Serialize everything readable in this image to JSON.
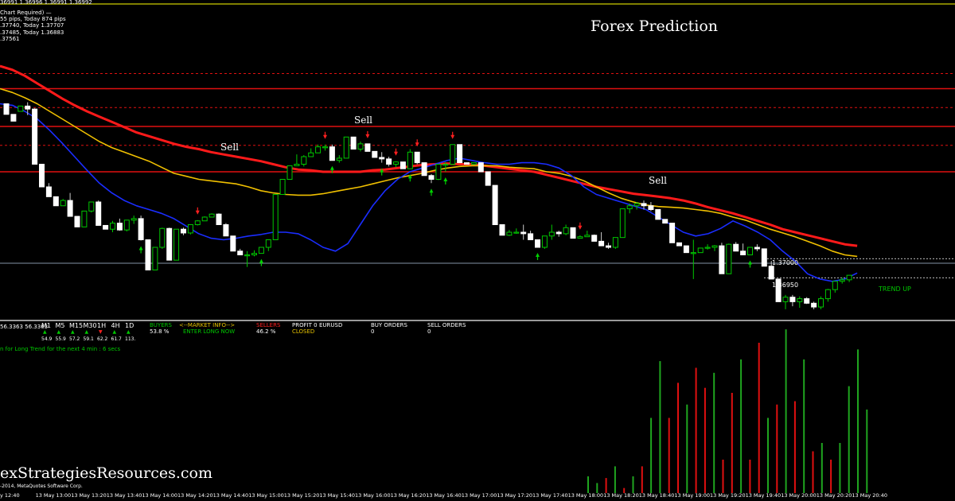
{
  "header": {
    "lines": [
      "36991 1.36996 1.36991 1.36992",
      "Chart Required) —",
      "55 pips, Today 874 pips",
      ".37740, Today 1.37707",
      ".37485, Today 1.36883",
      ".37561"
    ]
  },
  "title": "Forex Prediction",
  "signals": {
    "sell_label": "Sell"
  },
  "price_labels": {
    "upper": "1.37000",
    "lower": "1.36950"
  },
  "trend_label": "TREND UP",
  "info_panel": {
    "price": "56.3363 56.3363",
    "timeframes": [
      "M1",
      "M5",
      "M15",
      "M30",
      "1H",
      "4H",
      "1D"
    ],
    "tf_values": [
      "54.9",
      "55.9",
      "57.2",
      "59.1",
      "62.2",
      "61.7",
      "113."
    ],
    "tf_directions": [
      "up",
      "up",
      "up",
      "up",
      "down",
      "up",
      "up"
    ],
    "buyers_label": "BUYERS",
    "buyers_value": "53.8 %",
    "market_info": "<--MARKET INFO-->",
    "market_action": "ENTER LONG NOW",
    "sellers_label": "SELLERS",
    "sellers_value": "46.2 %",
    "profit_label": "PROFIT 0",
    "symbol": "EURUSD",
    "status": "CLOSED",
    "buy_orders_label": "BUY ORDERS",
    "buy_orders_value": "0",
    "sell_orders_label": "SELL ORDERS",
    "sell_orders_value": "0",
    "trend_message": "n for Long Trend for the next 4 min : 6 secs"
  },
  "footer": {
    "watermark": "exStrategiesResources.com",
    "copyright": "-2014, MetaQuotes Software Corp."
  },
  "time_axis": [
    "y 12:40",
    "13 May 13:00",
    "13 May 13:20",
    "13 May 13:40",
    "13 May 14:00",
    "13 May 14:20",
    "13 May 14:40",
    "13 May 15:00",
    "13 May 15:20",
    "13 May 15:40",
    "13 May 16:00",
    "13 May 16:20",
    "13 May 16:40",
    "13 May 17:00",
    "13 May 17:20",
    "13 May 17:40",
    "13 May 18:00",
    "13 May 18:20",
    "13 May 18:40",
    "13 May 19:00",
    "13 May 19:20",
    "13 May 19:40",
    "13 May 20:00",
    "13 May 20:20",
    "13 May 20:40"
  ],
  "colors": {
    "bull_candle": "#00c800",
    "bear_candle": "#ffffff",
    "ma_fast": "#1a2dff",
    "ma_mid": "#f0c000",
    "ma_slow": "#ff1a1a",
    "level_line": "#e01010",
    "hist_up": "#1fa51f",
    "hist_down": "#e01010"
  },
  "chart_data": {
    "type": "candlestick",
    "candles": [
      [
        0.9,
        0.9,
        0.76,
        0.76
      ],
      [
        0.76,
        0.76,
        0.67,
        0.67
      ],
      [
        0.8,
        0.87,
        0.8,
        0.87
      ],
      [
        0.87,
        0.92,
        0.75,
        0.83
      ],
      [
        0.83,
        0.84,
        0.1,
        0.1
      ],
      [
        0.1,
        0.1,
        -0.2,
        -0.2
      ],
      [
        -0.2,
        -0.15,
        -0.33,
        -0.33
      ],
      [
        -0.33,
        -0.33,
        -0.45,
        -0.45
      ],
      [
        -0.45,
        -0.36,
        -0.45,
        -0.38
      ],
      [
        -0.38,
        -0.28,
        -0.59,
        -0.59
      ],
      [
        -0.59,
        -0.59,
        -0.73,
        -0.73
      ],
      [
        -0.73,
        -0.52,
        -0.73,
        -0.52
      ],
      [
        -0.52,
        -0.4,
        -0.54,
        -0.4
      ],
      [
        -0.4,
        -0.38,
        -0.71,
        -0.71
      ],
      [
        -0.71,
        -0.71,
        -0.76,
        -0.76
      ],
      [
        -0.76,
        -0.65,
        -0.8,
        -0.68
      ],
      [
        -0.68,
        -0.62,
        -0.78,
        -0.77
      ],
      [
        -0.77,
        -0.64,
        -0.79,
        -0.64
      ],
      [
        -0.64,
        -0.58,
        -0.69,
        -0.62
      ],
      [
        -0.62,
        -0.58,
        -0.91,
        -0.9
      ],
      [
        -0.9,
        -0.9,
        -1.3,
        -1.3
      ],
      [
        -1.3,
        -1.0,
        -1.3,
        -1.0
      ],
      [
        -1.0,
        -0.74,
        -1.02,
        -0.75
      ],
      [
        -0.75,
        -0.74,
        -1.17,
        -1.17
      ],
      [
        -1.17,
        -0.76,
        -1.17,
        -0.76
      ],
      [
        -0.76,
        -0.74,
        -0.84,
        -0.81
      ],
      [
        -0.81,
        -0.7,
        -0.83,
        -0.7
      ],
      [
        -0.7,
        -0.64,
        -0.71,
        -0.65
      ],
      [
        -0.65,
        -0.59,
        -0.65,
        -0.6
      ],
      [
        -0.6,
        -0.55,
        -0.6,
        -0.56
      ],
      [
        -0.56,
        -0.55,
        -0.7,
        -0.7
      ],
      [
        -0.7,
        -0.68,
        -0.85,
        -0.85
      ],
      [
        -0.85,
        -0.85,
        -1.05,
        -1.05
      ],
      [
        -1.05,
        -1.02,
        -1.1,
        -1.1
      ],
      [
        -1.1,
        -1.05,
        -1.26,
        -1.1
      ],
      [
        -1.1,
        -1.04,
        -1.12,
        -1.08
      ],
      [
        -1.08,
        -1.0,
        -1.08,
        -1.0
      ],
      [
        -1.0,
        -0.9,
        -1.05,
        -0.9
      ],
      [
        -0.9,
        -0.3,
        -0.9,
        -0.3
      ],
      [
        -0.3,
        -0.1,
        -0.3,
        -0.1
      ],
      [
        -0.1,
        0.08,
        -0.1,
        0.08
      ],
      [
        0.08,
        0.23,
        0.08,
        0.1
      ],
      [
        0.1,
        0.22,
        0.07,
        0.2
      ],
      [
        0.2,
        0.31,
        0.2,
        0.25
      ],
      [
        0.25,
        0.36,
        0.25,
        0.33
      ],
      [
        0.33,
        0.36,
        0.28,
        0.33
      ],
      [
        0.33,
        0.36,
        0.15,
        0.15
      ],
      [
        0.15,
        0.22,
        0.12,
        0.18
      ],
      [
        0.18,
        0.46,
        0.18,
        0.46
      ],
      [
        0.46,
        0.46,
        0.3,
        0.3
      ],
      [
        0.3,
        0.4,
        0.27,
        0.37
      ],
      [
        0.37,
        0.37,
        0.27,
        0.27
      ],
      [
        0.27,
        0.27,
        0.19,
        0.19
      ],
      [
        0.19,
        0.26,
        0.12,
        0.17
      ],
      [
        0.17,
        0.2,
        0.07,
        0.1
      ],
      [
        0.1,
        0.14,
        0.06,
        0.13
      ],
      [
        0.13,
        0.13,
        0.04,
        0.04
      ],
      [
        0.04,
        0.3,
        0.04,
        0.26
      ],
      [
        0.26,
        0.26,
        0.1,
        0.12
      ],
      [
        0.12,
        0.12,
        -0.05,
        -0.05
      ],
      [
        -0.05,
        -0.03,
        -0.15,
        -0.1
      ],
      [
        -0.1,
        0.1,
        -0.11,
        0.1
      ],
      [
        0.1,
        0.13,
        0.0,
        0.1
      ],
      [
        0.1,
        0.36,
        0.09,
        0.36
      ],
      [
        0.36,
        0.36,
        0.12,
        0.12
      ],
      [
        0.12,
        0.12,
        0.1,
        0.1
      ],
      [
        0.1,
        0.12,
        0.09,
        0.12
      ],
      [
        0.12,
        0.12,
        0.0,
        0.0
      ],
      [
        0.0,
        0.0,
        -0.18,
        -0.18
      ],
      [
        -0.18,
        -0.18,
        -0.7,
        -0.7
      ],
      [
        -0.7,
        -0.7,
        -0.84,
        -0.84
      ],
      [
        -0.84,
        -0.77,
        -0.85,
        -0.8
      ],
      [
        -0.8,
        -0.75,
        -0.82,
        -0.8
      ],
      [
        -0.8,
        -0.7,
        -0.9,
        -0.82
      ],
      [
        -0.82,
        -0.78,
        -0.9,
        -0.9
      ],
      [
        -0.9,
        -0.9,
        -1.0,
        -1.0
      ],
      [
        -1.0,
        -0.85,
        -1.02,
        -0.85
      ],
      [
        -0.85,
        -0.7,
        -0.9,
        -0.8
      ],
      [
        -0.8,
        -0.78,
        -0.86,
        -0.82
      ],
      [
        -0.82,
        -0.7,
        -0.84,
        -0.74
      ],
      [
        -0.74,
        -0.74,
        -0.88,
        -0.88
      ],
      [
        -0.88,
        -0.84,
        -0.88,
        -0.86
      ],
      [
        -0.86,
        -0.78,
        -0.86,
        -0.84
      ],
      [
        -0.84,
        -0.83,
        -0.92,
        -0.92
      ],
      [
        -0.92,
        -0.8,
        -0.98,
        -0.98
      ],
      [
        -0.98,
        -0.94,
        -1.02,
        -1.0
      ],
      [
        -1.0,
        -0.87,
        -1.02,
        -0.87
      ],
      [
        -0.87,
        -0.49,
        -0.87,
        -0.49
      ],
      [
        -0.49,
        -0.42,
        -0.55,
        -0.45
      ],
      [
        -0.45,
        -0.4,
        -0.5,
        -0.42
      ],
      [
        -0.42,
        -0.38,
        -0.5,
        -0.45
      ],
      [
        -0.45,
        -0.4,
        -0.52,
        -0.5
      ],
      [
        -0.5,
        -0.5,
        -0.63,
        -0.63
      ],
      [
        -0.63,
        -0.63,
        -0.68,
        -0.68
      ],
      [
        -0.68,
        -0.68,
        -0.94,
        -0.94
      ],
      [
        -0.94,
        -0.94,
        -0.98,
        -0.98
      ],
      [
        -0.98,
        -0.98,
        -1.07,
        -1.07
      ],
      [
        -1.07,
        -0.9,
        -1.42,
        -1.07
      ],
      [
        -1.07,
        -1.01,
        -1.07,
        -1.01
      ],
      [
        -1.01,
        -0.96,
        -1.03,
        -1.0
      ],
      [
        -1.0,
        -0.97,
        -1.05,
        -0.98
      ],
      [
        -0.98,
        -0.94,
        -1.35,
        -1.35
      ],
      [
        -1.35,
        -0.95,
        -1.35,
        -0.96
      ],
      [
        -0.96,
        -0.93,
        -1.05,
        -1.05
      ],
      [
        -1.05,
        -0.95,
        -1.1,
        -1.1
      ],
      [
        -1.1,
        -1.0,
        -1.1,
        -1.0
      ],
      [
        -1.0,
        -0.96,
        -1.05,
        -1.02
      ],
      [
        -1.02,
        -1.02,
        -1.25,
        -1.25
      ],
      [
        -1.25,
        -1.18,
        -1.42,
        -1.42
      ],
      [
        -1.42,
        -1.42,
        -1.72,
        -1.72
      ],
      [
        -1.72,
        -1.63,
        -1.82,
        -1.66
      ],
      [
        -1.66,
        -1.63,
        -1.78,
        -1.72
      ],
      [
        -1.72,
        -1.65,
        -1.8,
        -1.68
      ],
      [
        -1.68,
        -1.66,
        -1.75,
        -1.74
      ],
      [
        -1.74,
        -1.72,
        -1.82,
        -1.79
      ],
      [
        -1.79,
        -1.65,
        -1.82,
        -1.68
      ],
      [
        -1.68,
        -1.55,
        -1.72,
        -1.56
      ],
      [
        -1.56,
        -1.45,
        -1.6,
        -1.45
      ],
      [
        -1.45,
        -1.4,
        -1.48,
        -1.43
      ],
      [
        -1.43,
        -1.37,
        -1.46,
        -1.37
      ]
    ],
    "ma_fast": [
      0.9,
      0.88,
      0.8,
      0.7,
      0.55,
      0.38,
      0.2,
      0.02,
      -0.15,
      -0.28,
      -0.38,
      -0.45,
      -0.5,
      -0.55,
      -0.62,
      -0.72,
      -0.82,
      -0.88,
      -0.9,
      -0.88,
      -0.85,
      -0.83,
      -0.8,
      -0.8,
      -0.82,
      -0.9,
      -1.0,
      -1.05,
      -0.95,
      -0.7,
      -0.45,
      -0.25,
      -0.1,
      0.0,
      0.05,
      0.1,
      0.15,
      0.18,
      0.15,
      0.12,
      0.1,
      0.1,
      0.12,
      0.12,
      0.1,
      0.05,
      -0.05,
      -0.2,
      -0.3,
      -0.35,
      -0.4,
      -0.45,
      -0.5,
      -0.6,
      -0.7,
      -0.8,
      -0.85,
      -0.82,
      -0.75,
      -0.65,
      -0.72,
      -0.8,
      -0.9,
      -1.05,
      -1.18,
      -1.35,
      -1.42,
      -1.45,
      -1.42,
      -1.34
    ],
    "ma_mid": [
      1.1,
      1.05,
      0.98,
      0.9,
      0.8,
      0.7,
      0.6,
      0.5,
      0.4,
      0.32,
      0.26,
      0.2,
      0.14,
      0.06,
      -0.02,
      -0.06,
      -0.1,
      -0.12,
      -0.14,
      -0.16,
      -0.2,
      -0.25,
      -0.28,
      -0.3,
      -0.31,
      -0.31,
      -0.29,
      -0.26,
      -0.23,
      -0.2,
      -0.16,
      -0.12,
      -0.08,
      -0.05,
      -0.02,
      0.02,
      0.05,
      0.07,
      0.08,
      0.08,
      0.08,
      0.06,
      0.05,
      0.04,
      0.0,
      -0.02,
      -0.06,
      -0.12,
      -0.2,
      -0.28,
      -0.35,
      -0.4,
      -0.44,
      -0.46,
      -0.47,
      -0.48,
      -0.5,
      -0.52,
      -0.55,
      -0.6,
      -0.64,
      -0.7,
      -0.76,
      -0.81,
      -0.86,
      -0.92,
      -0.98,
      -1.05,
      -1.1,
      -1.12
    ],
    "ma_slow": [
      1.4,
      1.35,
      1.27,
      1.17,
      1.07,
      0.97,
      0.88,
      0.8,
      0.73,
      0.66,
      0.59,
      0.52,
      0.47,
      0.42,
      0.37,
      0.33,
      0.3,
      0.26,
      0.23,
      0.2,
      0.17,
      0.14,
      0.1,
      0.06,
      0.03,
      0.02,
      0.0,
      0.0,
      0.0,
      0.0,
      0.02,
      0.03,
      0.05,
      0.07,
      0.09,
      0.1,
      0.11,
      0.1,
      0.1,
      0.08,
      0.06,
      0.04,
      0.02,
      0.0,
      -0.04,
      -0.08,
      -0.12,
      -0.16,
      -0.2,
      -0.23,
      -0.26,
      -0.29,
      -0.31,
      -0.33,
      -0.35,
      -0.38,
      -0.42,
      -0.47,
      -0.51,
      -0.55,
      -0.6,
      -0.65,
      -0.7,
      -0.76,
      -0.8,
      -0.84,
      -0.88,
      -0.92,
      -0.96,
      -0.98
    ],
    "levels_solid": [
      1.1,
      0.6,
      0.0
    ],
    "levels_dashed": [
      1.3,
      0.85,
      0.35
    ],
    "current_level": -1.15,
    "sell_signals": [
      {
        "i": 16
      },
      {
        "i": 26
      },
      {
        "i": 47
      }
    ],
    "down_arrows": [
      16,
      26,
      30,
      32,
      34,
      37,
      47
    ],
    "up_arrows": [
      11,
      21,
      27,
      31,
      33,
      35,
      36,
      44,
      61
    ],
    "histogram": [
      [
        1,
        0.1
      ],
      [
        1,
        0.06
      ],
      [
        -1,
        0.09
      ],
      [
        1,
        0.16
      ],
      [
        -1,
        0.03
      ],
      [
        1,
        0.1
      ],
      [
        -1,
        0.16
      ],
      [
        1,
        0.45
      ],
      [
        1,
        0.79
      ],
      [
        -1,
        0.45
      ],
      [
        -1,
        0.66
      ],
      [
        1,
        0.53
      ],
      [
        -1,
        0.75
      ],
      [
        -1,
        0.63
      ],
      [
        1,
        0.72
      ],
      [
        -1,
        0.2
      ],
      [
        -1,
        0.6
      ],
      [
        1,
        0.8
      ],
      [
        -1,
        0.2
      ],
      [
        -1,
        0.9
      ],
      [
        1,
        0.45
      ],
      [
        -1,
        0.53
      ],
      [
        1,
        0.98
      ],
      [
        -1,
        0.55
      ],
      [
        1,
        0.8
      ],
      [
        -1,
        0.25
      ],
      [
        1,
        0.3
      ],
      [
        -1,
        0.2
      ],
      [
        1,
        0.3
      ],
      [
        1,
        0.64
      ],
      [
        1,
        0.86
      ],
      [
        1,
        0.5
      ]
    ]
  }
}
